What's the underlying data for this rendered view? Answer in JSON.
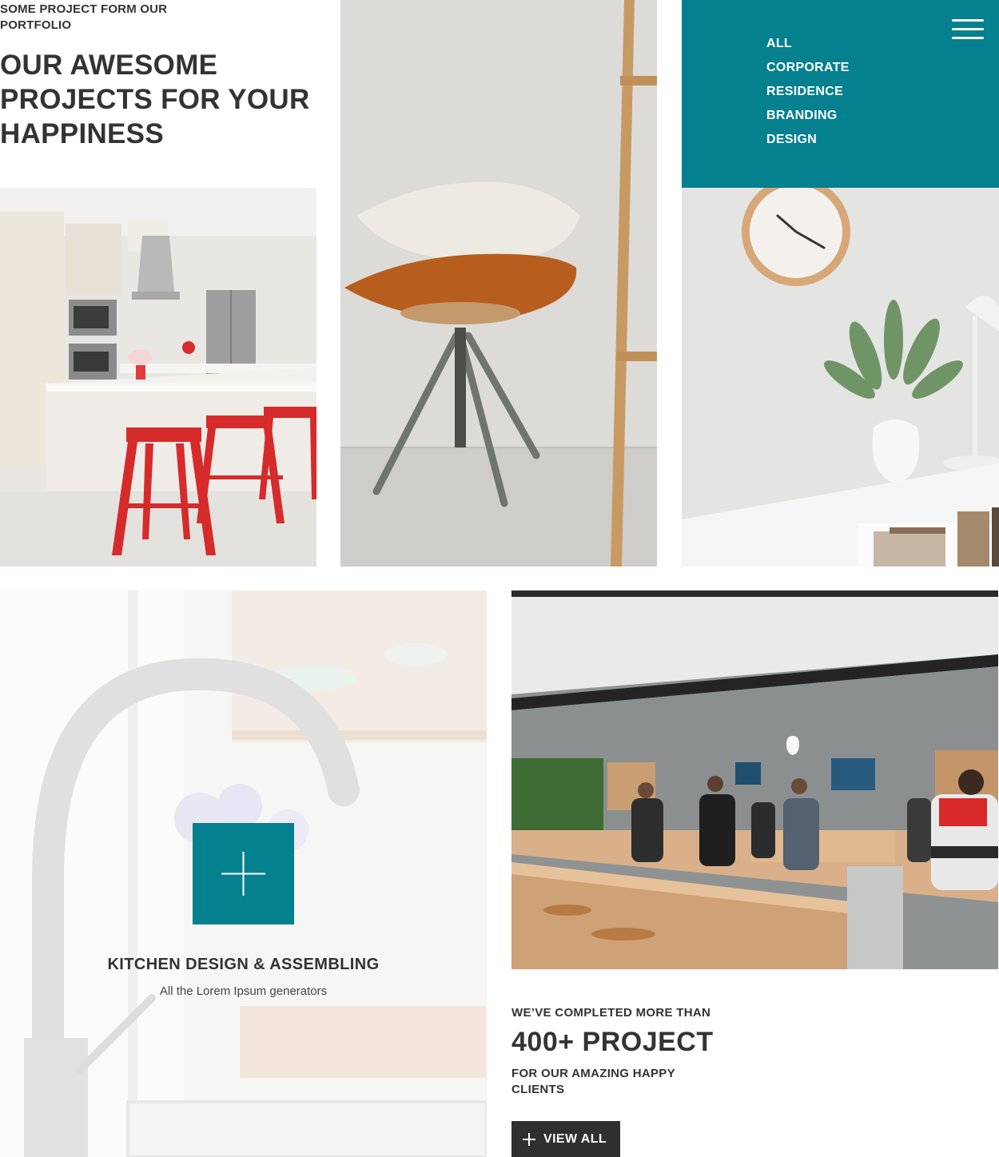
{
  "intro": {
    "eyebrow": "SOME PROJECT FORM OUR PORTFOLIO",
    "headline": "OUR AWESOME PROJECTS FOR YOUR HAPPINESS"
  },
  "filters": {
    "items": [
      "ALL",
      "CORPORATE",
      "RESIDENCE",
      "BRANDING",
      "DESIGN"
    ],
    "menu_icon": "hamburger-menu-icon"
  },
  "gallery": {
    "images": [
      "kitchen-red-stools-photo",
      "pillows-on-stool-photo",
      "wall-clock-plant-photo",
      "kitchen-faucet-photo",
      "apple-store-photo"
    ]
  },
  "feature": {
    "icon": "plus-icon",
    "title": "KITCHEN DESIGN & ASSEMBLING",
    "subtitle": "All the Lorem Ipsum generators"
  },
  "stats": {
    "pre": "WE’VE COMPLETED MORE THAN",
    "big": "400+ PROJECT",
    "post": "FOR OUR AMAZING HAPPY CLIENTS",
    "button_label": "VIEW ALL",
    "button_icon": "plus-icon"
  },
  "colors": {
    "accent": "#05808f",
    "dark": "#2f2f2f",
    "text": "#333333"
  }
}
